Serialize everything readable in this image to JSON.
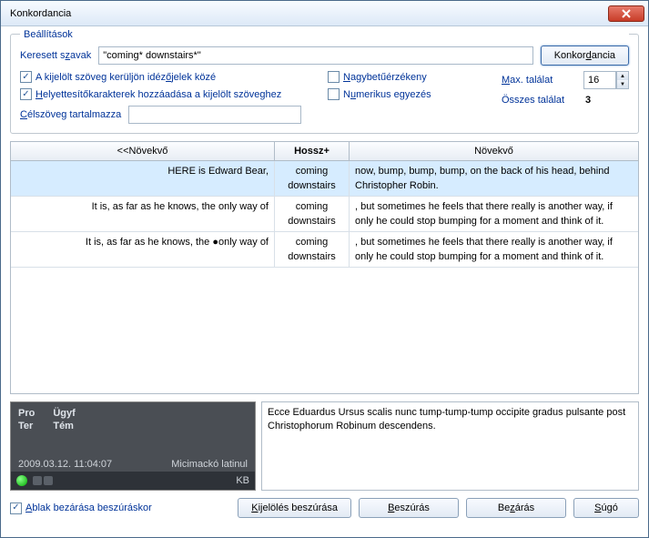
{
  "window": {
    "title": "Konkordancia"
  },
  "settings": {
    "legend": "Beállítások",
    "search_label_pre": "Keresett s",
    "search_label_u": "z",
    "search_label_post": "avak",
    "search_value": "\"coming* downstairs*\"",
    "concordance_btn_pre": "Konkor",
    "concordance_btn_u": "d",
    "concordance_btn_post": "ancia",
    "cb_quote_pre": "A kijelölt szöveg kerüljön idéz",
    "cb_quote_u": "ő",
    "cb_quote_post": "jelek közé",
    "cb_case_u": "N",
    "cb_case_post": "agybetűérzékeny",
    "cb_wild_u": "H",
    "cb_wild_post": "elyettesítőkarakterek hozzáadása a kijelölt szöveghez",
    "cb_num_pre": "N",
    "cb_num_u": "u",
    "cb_num_post": "merikus egyezés",
    "target_label_u": "C",
    "target_label_post": "élszöveg tartalmazza",
    "target_value": "",
    "max_label_u": "M",
    "max_label_post": "ax. találat",
    "max_value": "16",
    "total_label": "Összes találat",
    "total_value": "3"
  },
  "table": {
    "headers": [
      "<<Növekvő",
      "Hossz+",
      "Növekvő"
    ],
    "rows": [
      {
        "left": "HERE is Edward Bear,",
        "mid": "coming downstairs",
        "right": " now, bump, bump, bump, on the back of his head, behind Christopher Robin."
      },
      {
        "left": "It is, as far as he knows, the only way of",
        "mid": "coming downstairs",
        "right": ", but sometimes he feels that there really is another way, if only he could stop bumping for a moment and think of it."
      },
      {
        "left": "It is, as far as he knows, the ●only way of",
        "mid": "coming downstairs",
        "right": ", but sometimes he feels that there really is another way, if only he could stop bumping for a moment and think of it."
      }
    ]
  },
  "meta": {
    "pro": "Pro",
    "ter": "Ter",
    "ugyf": "Ügyf",
    "tem": "Tém",
    "timestamp": "2009.03.12. 11:04:07",
    "source": "Micimackó latinul",
    "kb": "KB"
  },
  "preview": {
    "text": "Ecce Eduardus Ursus scalis nunc tump-tump-tump occipite gradus pulsante post Christophorum Robinum descendens."
  },
  "footer": {
    "cb_close_u": "A",
    "cb_close_post": "blak bezárása beszúráskor",
    "btn_insert_sel_u": "K",
    "btn_insert_sel_post": "ijelölés beszúrása",
    "btn_insert_u": "B",
    "btn_insert_post": "eszúrás",
    "btn_close_pre": "Be",
    "btn_close_u": "z",
    "btn_close_post": "árás",
    "btn_help_u": "S",
    "btn_help_post": "úgó"
  }
}
